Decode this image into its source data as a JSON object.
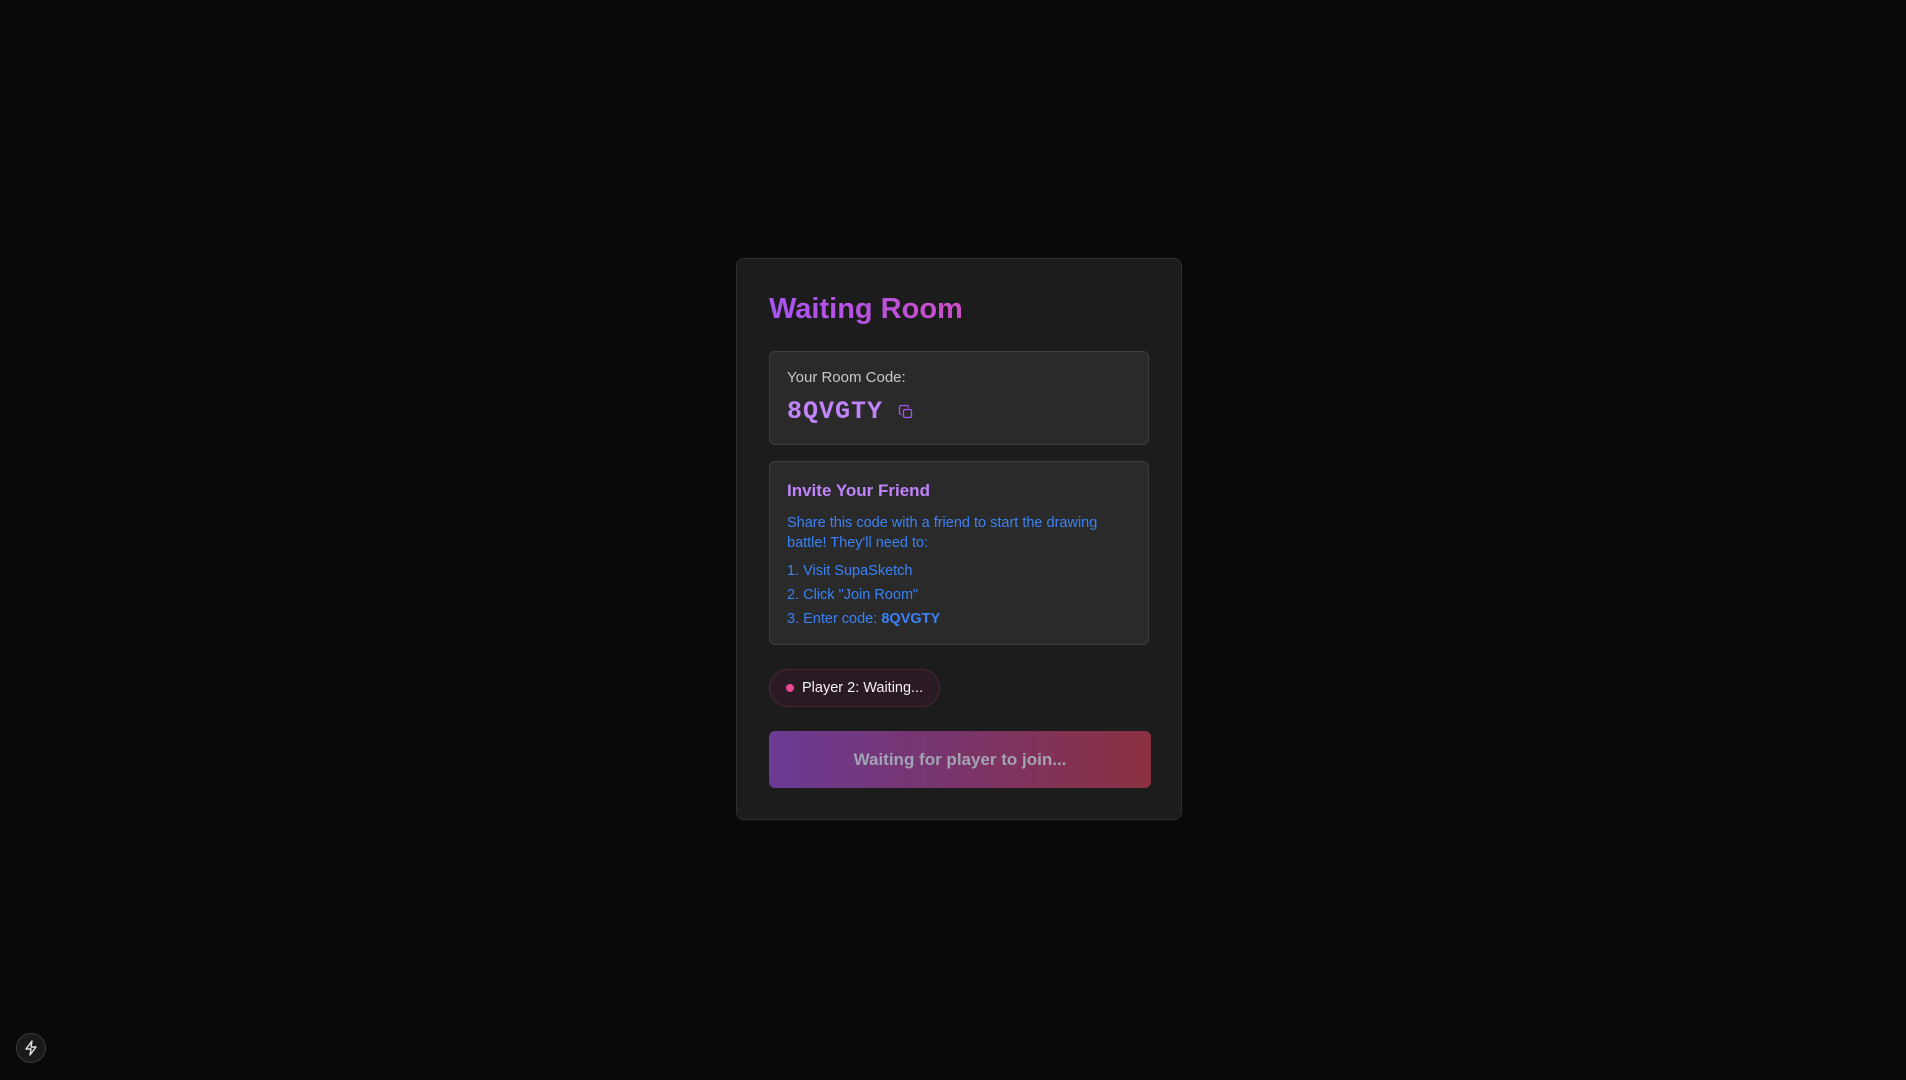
{
  "card": {
    "title": "Waiting Room"
  },
  "room_code": {
    "label": "Your Room Code:",
    "value": "8QVGTY",
    "copy_icon": "copy-icon"
  },
  "invite": {
    "title": "Invite Your Friend",
    "description": "Share this code with a friend to start the drawing battle! They'll need to:",
    "steps": {
      "step1": "1. Visit SupaSketch",
      "step2": "2. Click \"Join Room\"",
      "step3_prefix": "3. Enter code: ",
      "step3_code": "8QVGTY"
    }
  },
  "status": {
    "text": "Player 2: Waiting...",
    "color": "#ec4899"
  },
  "action_button": {
    "label": "Waiting for player to join..."
  },
  "floating": {
    "icon": "bolt-icon"
  },
  "colors": {
    "background": "#0a0a0a",
    "accent_purple": "#c084fc",
    "link_blue": "#3b82f6",
    "accent_pink": "#ec4899"
  }
}
